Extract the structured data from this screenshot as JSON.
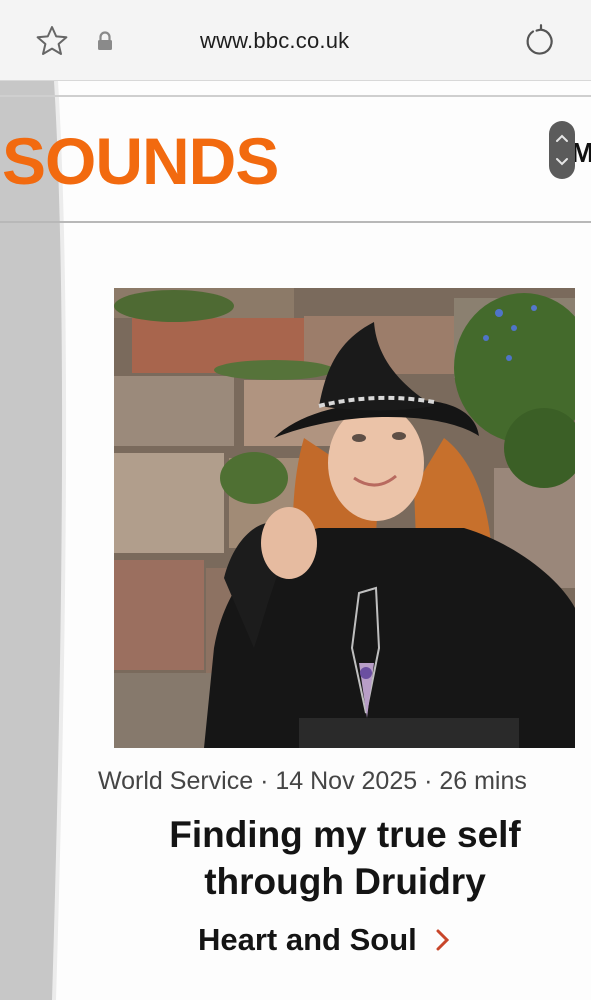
{
  "browser": {
    "url": "www.bbc.co.uk",
    "icons": [
      "star-icon",
      "lock-icon",
      "reload-icon"
    ]
  },
  "header": {
    "logo_text": "SOUNDS",
    "logo_color": "#f26a0f",
    "menu_peek": "M"
  },
  "episode": {
    "image_subject": "woman in a black witch-style hat with a crystal pendant in front of a mossy stone wall",
    "meta": "World Service · 14 Nov 2025 · 26 mins",
    "title": "Finding my true self through Druidry",
    "brand": "Heart and Soul",
    "accent_color": "#c8462a"
  }
}
